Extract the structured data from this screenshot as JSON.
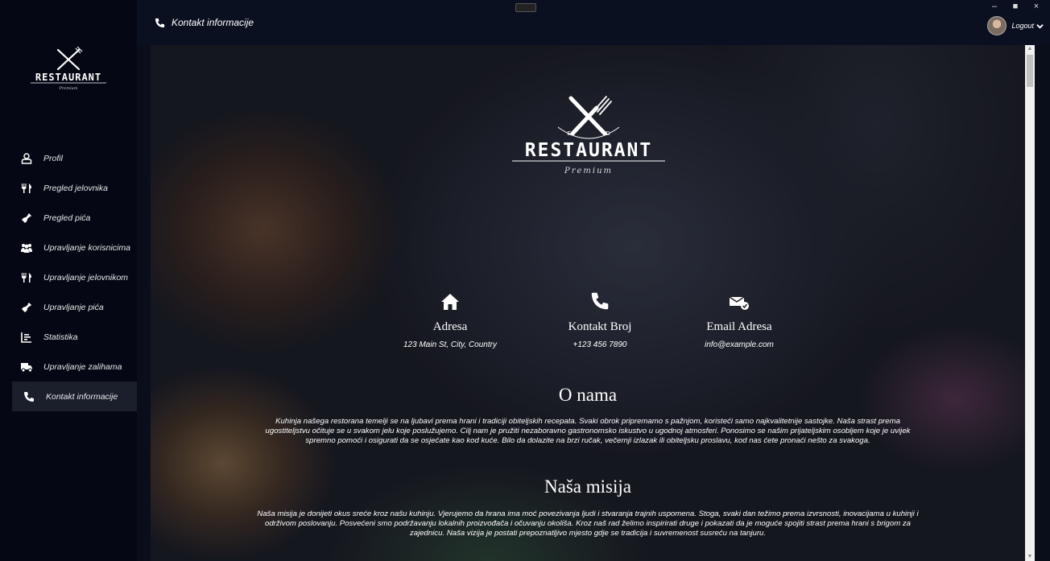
{
  "window": {
    "minimize": "–",
    "maximize": "■",
    "close": "×"
  },
  "brand": {
    "name": "RESTAURANT",
    "tagline": "Premium",
    "est_left": "ES",
    "est_right": "TD"
  },
  "sidebar": {
    "items": [
      {
        "label": "Profil",
        "icon": "user-icon"
      },
      {
        "label": "Pregled jelovnika",
        "icon": "utensils-icon"
      },
      {
        "label": "Pregled pića",
        "icon": "wine-bottle-icon"
      },
      {
        "label": "Upravljanje korisnicima",
        "icon": "users-icon"
      },
      {
        "label": "Upravljanje jelovnikom",
        "icon": "utensils-icon"
      },
      {
        "label": "Upravljanje pića",
        "icon": "wine-bottle-icon"
      },
      {
        "label": "Statistika",
        "icon": "chart-icon"
      },
      {
        "label": "Upravljanje zalihama",
        "icon": "truck-icon"
      },
      {
        "label": "Kontakt informacije",
        "icon": "phone-icon",
        "active": true
      }
    ]
  },
  "header": {
    "title": "Kontakt informacije",
    "logout_label": "Logout"
  },
  "contacts": {
    "address": {
      "label": "Adresa",
      "value": "123 Main St, City, Country"
    },
    "phone": {
      "label": "Kontakt Broj",
      "value": "+123 456 7890"
    },
    "email": {
      "label": "Email Adresa",
      "value": "info@example.com"
    }
  },
  "about": {
    "title": "O nama",
    "lines": [
      "Kuhinja našega restorana temelji se na ljubavi prema hrani i tradiciji obiteljskih recepata. Svaki obrok pripremamo s pažnjom, koristeći samo najkvalitetnije sastojke. Naša strast prema",
      "ugostiteljstvu očituje se u svakom jelu koje poslužujemo. Cilj nam je pružiti nezaboravno gastronomsko iskustvo u ugodnoj atmosferi. Ponosimo se našim prijateljskim osobljem koje je uvijek",
      "spremno pomoći i osigurati da se osjećate kao kod kuće. Bilo da dolazite na brzi ručak, večernji izlazak ili obiteljsku proslavu, kod nas ćete pronaći nešto za svakoga."
    ]
  },
  "mission": {
    "title": "Naša misija",
    "lines": [
      "Naša misija je donijeti okus sreće kroz našu kuhinju. Vjerujemo da hrana ima moć povezivanja ljudi i stvaranja trajnih uspomena. Stoga, svaki dan težimo prema izvrsnosti, inovacijama u kuhinji i",
      "održivom poslovanju. Posvećeni smo podržavanju lokalnih proizvođača i očuvanju okoliša. Kroz naš rad želimo inspirirati druge i pokazati da je moguće spojiti strast prema hrani s brigom za",
      "zajednicu. Naša vizija je postati prepoznatljivo mjesto gdje se tradicija i suvremenost susreću na tanjuru."
    ]
  }
}
